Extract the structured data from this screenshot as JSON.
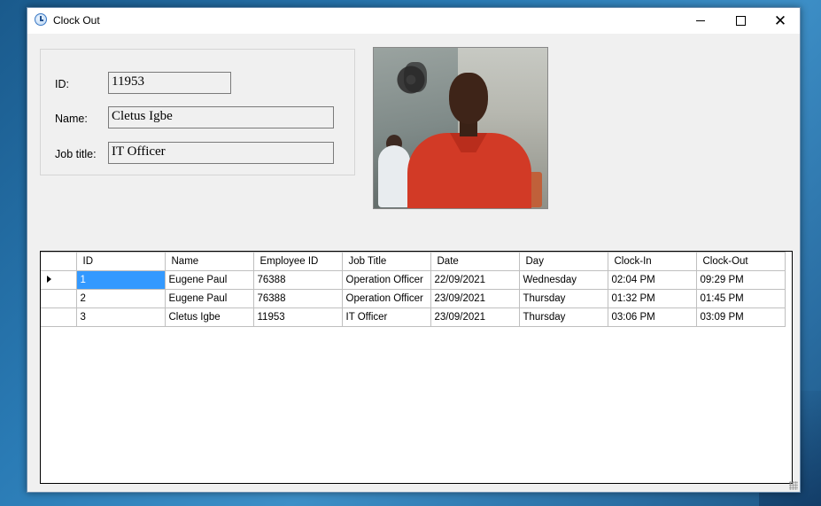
{
  "window": {
    "title": "Clock Out"
  },
  "employee": {
    "id_label": "ID:",
    "id_value": "11953",
    "name_label": "Name:",
    "name_value": "Cletus Igbe",
    "job_label": "Job title:",
    "job_value": "IT Officer"
  },
  "table": {
    "columns": [
      "ID",
      "Name",
      "Employee ID",
      "Job Title",
      "Date",
      "Day",
      "Clock-In",
      "Clock-Out"
    ],
    "rows": [
      [
        "1",
        "Eugene Paul",
        "76388",
        "Operation Officer",
        "22/09/2021",
        "Wednesday",
        "02:04 PM",
        "09:29 PM"
      ],
      [
        "2",
        "Eugene Paul",
        "76388",
        "Operation Officer",
        "23/09/2021",
        "Thursday",
        "01:32 PM",
        "01:45 PM"
      ],
      [
        "3",
        "Cletus Igbe",
        "11953",
        "IT Officer",
        "23/09/2021",
        "Thursday",
        "03:06 PM",
        "03:09 PM"
      ]
    ]
  }
}
